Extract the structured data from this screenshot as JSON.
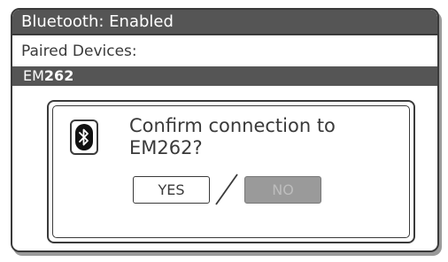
{
  "title_bar": {
    "text": "Bluetooth: Enabled"
  },
  "paired": {
    "label": "Paired Devices:",
    "devices": [
      {
        "prefix": "EM",
        "model": "262"
      }
    ]
  },
  "dialog": {
    "icon": "bluetooth-icon",
    "message_line1": "Confirm connection to",
    "message_line2": "EM262?",
    "yes_label": "YES",
    "separator": "/",
    "no_label": "NO"
  },
  "colors": {
    "title_bar_bg": "#555555",
    "selected_row_bg": "#555555",
    "disabled_button_bg": "#9a9a9a",
    "border": "#3a3a3a"
  }
}
